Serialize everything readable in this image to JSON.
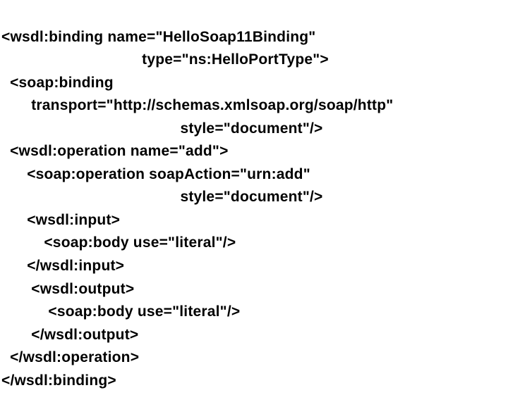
{
  "lines": {
    "l01": "<wsdl:binding name=\"HelloSoap11Binding\"",
    "l02": "                                 type=\"ns:HelloPortType\">",
    "l03": "  <soap:binding",
    "l04": "       transport=\"http://schemas.xmlsoap.org/soap/http\"",
    "l05": "                                          style=\"document\"/>",
    "l06": "  <wsdl:operation name=\"add\">",
    "l07": "      <soap:operation soapAction=\"urn:add\"",
    "l08": "                                          style=\"document\"/>",
    "l09": "      <wsdl:input>",
    "l10": "          <soap:body use=\"literal\"/>",
    "l11": "      </wsdl:input>",
    "l12": "       <wsdl:output>",
    "l13": "           <soap:body use=\"literal\"/>",
    "l14": "       </wsdl:output>",
    "l15": "  </wsdl:operation>",
    "l16": "</wsdl:binding>"
  }
}
